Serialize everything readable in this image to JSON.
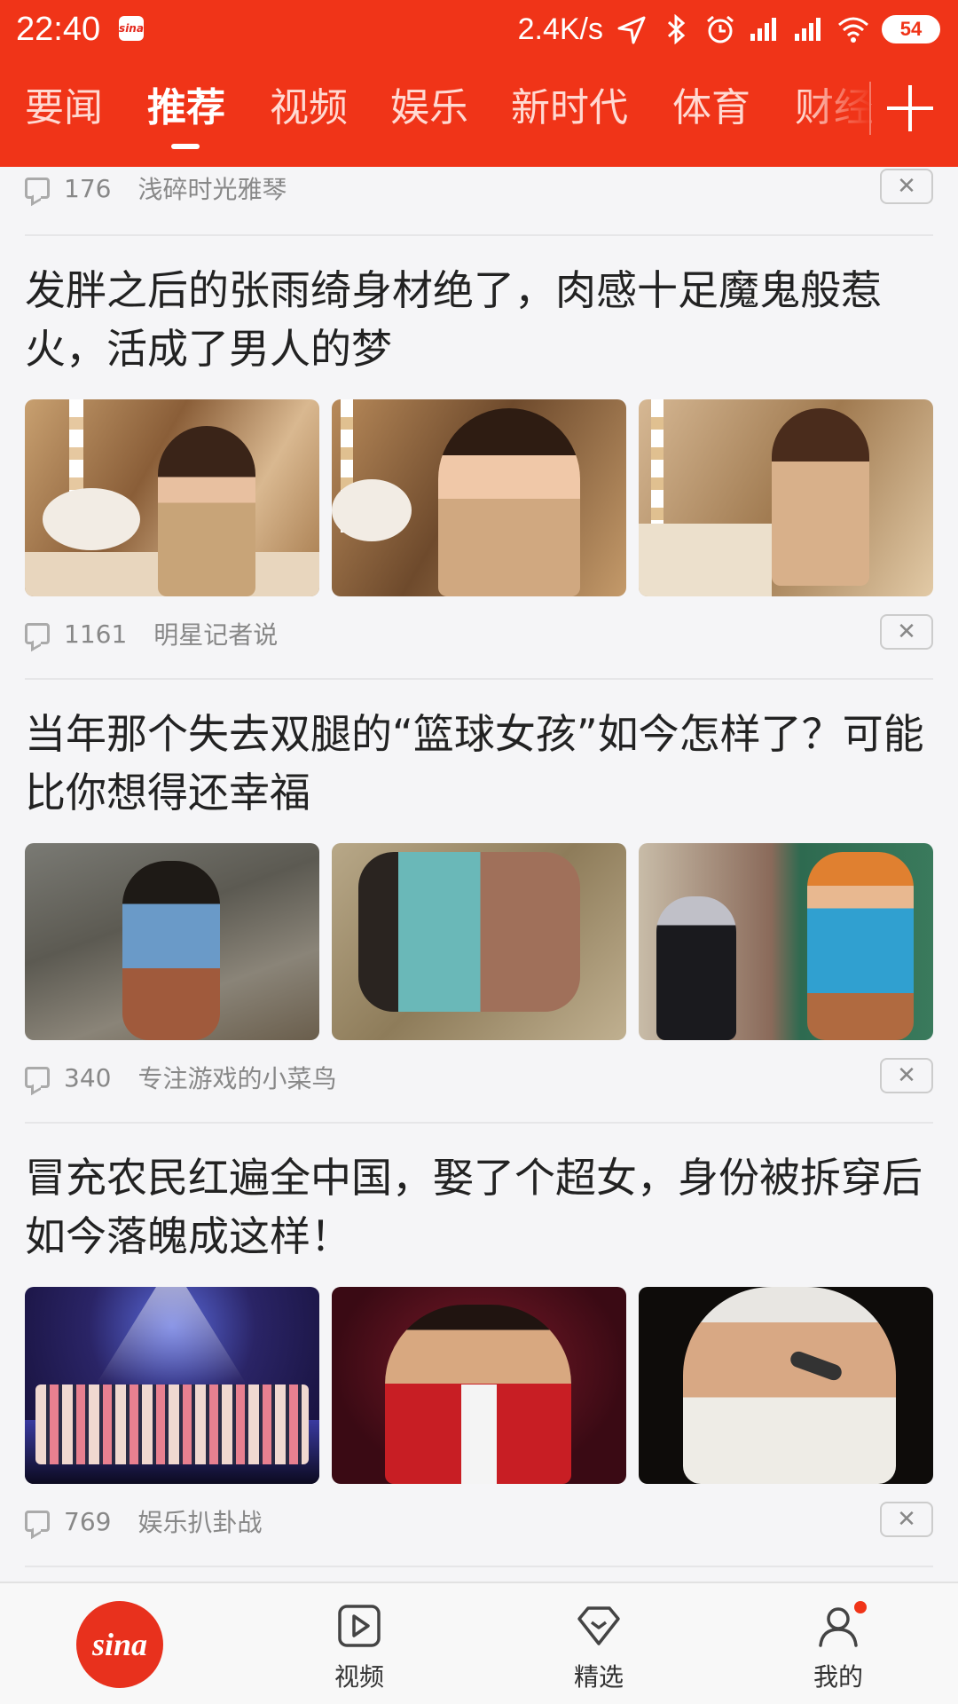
{
  "status_bar": {
    "time": "22:40",
    "app_badge": "sina",
    "net_speed": "2.4K/s",
    "battery": "54"
  },
  "channels": {
    "tabs": [
      "要闻",
      "推荐",
      "视频",
      "娱乐",
      "新时代",
      "体育",
      "财经"
    ],
    "active_index": 1,
    "add_label": "+"
  },
  "feed": {
    "top_meta": {
      "count": "176",
      "source": "浅碎时光雅琴"
    },
    "articles": [
      {
        "title": "发胖之后的张雨绮身材绝了，肉感十足魔鬼般惹火，活成了男人的梦",
        "count": "1161",
        "source": "明星记者说"
      },
      {
        "title": "当年那个失去双腿的“篮球女孩”如今怎样了？可能比你想得还幸福",
        "count": "340",
        "source": "专注游戏的小菜鸟"
      },
      {
        "title": "冒充农民红遍全中国，娶了个超女，身份被拆穿后如今落魄成这样！",
        "count": "769",
        "source": "娱乐扒卦战"
      }
    ],
    "dismiss_symbol": "✕"
  },
  "bottom_nav": {
    "home_logo": "sina",
    "items": [
      {
        "label": "视频",
        "icon": "play-icon"
      },
      {
        "label": "精选",
        "icon": "diamond-icon"
      },
      {
        "label": "我的",
        "icon": "profile-icon"
      }
    ]
  },
  "colors": {
    "brand_red": "#f03418",
    "background": "#f5f5f7",
    "text_primary": "#222222",
    "text_secondary": "#888888"
  }
}
